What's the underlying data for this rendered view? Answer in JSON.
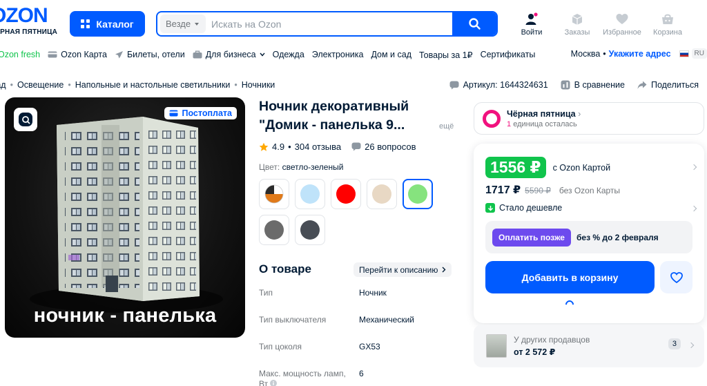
{
  "header": {
    "logo_text": "OZON",
    "logo_sub": "ЧЕРНАЯ ПЯТНИЦА",
    "catalog_label": "Каталог",
    "search_scope": "Везде",
    "search_placeholder": "Искать на Ozon",
    "icons": [
      {
        "name": "user-icon",
        "label": "Войти"
      },
      {
        "name": "orders-icon",
        "label": "Заказы"
      },
      {
        "name": "heart-icon",
        "label": "Избранное"
      },
      {
        "name": "cart-icon",
        "label": "Корзина"
      }
    ]
  },
  "nav": {
    "items": [
      {
        "icon": "",
        "label": "Ozon fresh",
        "green": true
      },
      {
        "icon": "card-icon",
        "label": "Ozon Карта"
      },
      {
        "icon": "plane-icon",
        "label": "Билеты, отели"
      },
      {
        "icon": "briefcase-icon",
        "label": "Для бизнеса",
        "dropdown": true
      },
      {
        "label": "Одежда"
      },
      {
        "label": "Электроника"
      },
      {
        "label": "Дом и сад"
      },
      {
        "label": "Товары за 1₽"
      },
      {
        "label": "Сертификаты"
      }
    ],
    "city": "Москва",
    "address_link": "Укажите адрес",
    "lang": "RU"
  },
  "breadcrumbs": [
    "Дом и сад",
    "Освещение",
    "Напольные и настольные светильники",
    "Ночники"
  ],
  "meta": {
    "sku": "Артикул: 1644324631",
    "compare": "В сравнение",
    "share": "Поделиться"
  },
  "gallery": {
    "badge": "Постоплата",
    "caption": "ночник - панелька"
  },
  "product": {
    "title": "Ночник декоративный \"Домик - панелька 9...",
    "more": "ещё",
    "rating": "4.9",
    "reviews": "304 отзыва",
    "questions": "26 вопросов",
    "color_label": "Цвет:",
    "color_value": "светло-зеленый",
    "swatches": [
      {
        "type": "pie",
        "colors": [
          "#ffffff",
          "#e07a1a",
          "#2a2a2a"
        ],
        "selected": false
      },
      {
        "color": "#bfe3fa",
        "selected": false
      },
      {
        "color": "#ff0000",
        "selected": false
      },
      {
        "color": "#e8d8c4",
        "selected": false
      },
      {
        "color": "#86e37e",
        "selected": true
      },
      {
        "color": "#6b6b6b",
        "selected": false
      },
      {
        "color": "#484d55",
        "selected": false
      }
    ]
  },
  "about": {
    "title": "О товаре",
    "to_desc": "Перейти к описанию",
    "specs": [
      {
        "key": "Тип",
        "value": "Ночник"
      },
      {
        "key": "Тип выключателя",
        "value": "Механический"
      },
      {
        "key": "Тип цоколя",
        "value": "GX53"
      },
      {
        "key": "Макс. мощность ламп, Вт",
        "value": "6"
      }
    ]
  },
  "promo": {
    "title": "Чёрная пятница",
    "count": "1",
    "rest": "единица осталась"
  },
  "buy": {
    "price_card": "1556 ₽",
    "with_card": "с Ozon Картой",
    "price": "1717 ₽",
    "old_price": "5590 ₽",
    "without_card": "без Ozon Карты",
    "cheaper": "Стало дешевле",
    "pay_later_btn": "Оплатить позже",
    "pay_later_text": "без % до 2 февраля",
    "add_to_cart": "Добавить в корзину"
  },
  "sellers": {
    "title": "У других продавцов",
    "from": "от 2 572 ₽",
    "count": "3"
  },
  "colors": {
    "brand": "#005bff",
    "green": "#10c44c",
    "pink": "#f1117e",
    "purple": "#6d4aee"
  }
}
